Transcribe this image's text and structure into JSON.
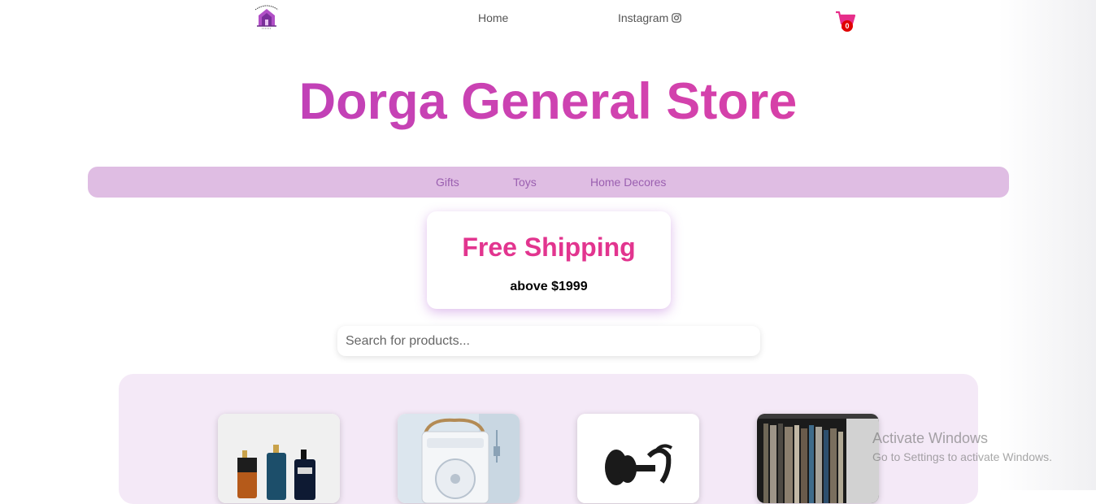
{
  "nav": {
    "home_label": "Home",
    "instagram_label": "Instagram",
    "cart_count": "0"
  },
  "hero": {
    "title": "Dorga General Store"
  },
  "categories": [
    "Gifts",
    "Toys",
    "Home Decores"
  ],
  "shipping": {
    "title": "Free Shipping",
    "subtitle": "above $1999"
  },
  "search": {
    "placeholder": "Search for products...",
    "value": ""
  },
  "products": [
    {
      "image": "perfume-bottles-image"
    },
    {
      "image": "mini-cooler-fan-image"
    },
    {
      "image": "fitness-logo-image"
    },
    {
      "image": "bookshelf-image"
    }
  ],
  "watermark": {
    "title": "Activate Windows",
    "subtitle": "Go to Settings to activate Windows."
  },
  "colors": {
    "title_gradient_start": "#b23fbe",
    "title_gradient_end": "#e13a9a",
    "category_bar": "#dfbde3",
    "shipping_title": "#e2358f",
    "panel_bg": "#f4e9f7",
    "cart_pink": "#e62e8a",
    "badge_red": "#e00000"
  }
}
